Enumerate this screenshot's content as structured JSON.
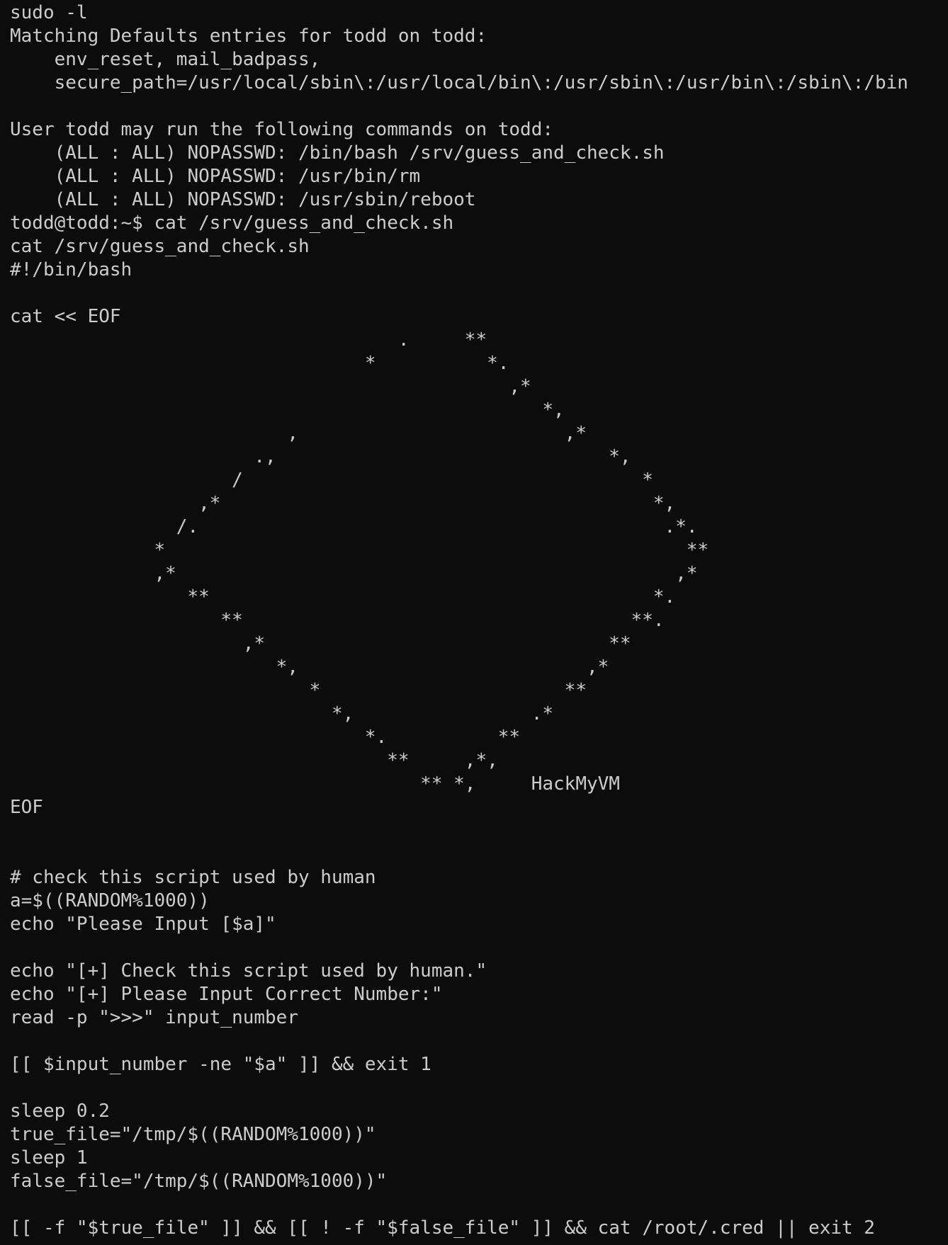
{
  "terminal": {
    "lines": [
      "sudo -l",
      "Matching Defaults entries for todd on todd:",
      "    env_reset, mail_badpass,",
      "    secure_path=/usr/local/sbin\\:/usr/local/bin\\:/usr/sbin\\:/usr/bin\\:/sbin\\:/bin",
      "",
      "User todd may run the following commands on todd:",
      "    (ALL : ALL) NOPASSWD: /bin/bash /srv/guess_and_check.sh",
      "    (ALL : ALL) NOPASSWD: /usr/bin/rm",
      "    (ALL : ALL) NOPASSWD: /usr/sbin/reboot",
      "todd@todd:~$ cat /srv/guess_and_check.sh",
      "cat /srv/guess_and_check.sh",
      "#!/bin/bash",
      "",
      "cat << EOF",
      "                                   .     **",
      "                                *          *.",
      "                                             ,*",
      "                                                *,",
      "                         ,                        ,*",
      "                      .,                              *,",
      "                    /                                    *",
      "                 ,*                                       *,",
      "               /.                                          .*.",
      "             *                                               **",
      "             ,*                                             ,*",
      "                **                                        *.",
      "                   **                                   **.",
      "                     ,*                               **",
      "                        *,                          ,*",
      "                           *                      **",
      "                             *,                .*",
      "                                *.          **",
      "                                  **     ,*,",
      "                                     ** *,     HackMyVM",
      "EOF",
      "",
      "",
      "# check this script used by human",
      "a=$((RANDOM%1000))",
      "echo \"Please Input [$a]\"",
      "",
      "echo \"[+] Check this script used by human.\"",
      "echo \"[+] Please Input Correct Number:\"",
      "read -p \">>>\" input_number",
      "",
      "[[ $input_number -ne \"$a\" ]] && exit 1",
      "",
      "sleep 0.2",
      "true_file=\"/tmp/$((RANDOM%1000))\"",
      "sleep 1",
      "false_file=\"/tmp/$((RANDOM%1000))\"",
      "",
      "[[ -f \"$true_file\" ]] && [[ ! -f \"$false_file\" ]] && cat /root/.cred || exit 2"
    ],
    "colors": {
      "background": "#0c0c0c",
      "foreground": "#cccccc"
    }
  }
}
